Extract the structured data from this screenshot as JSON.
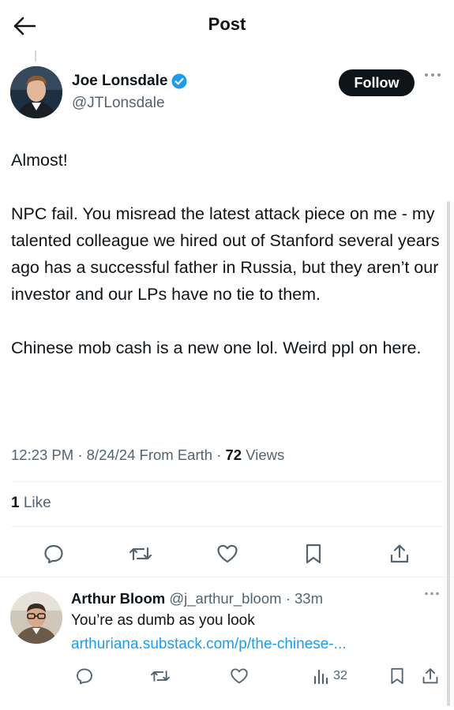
{
  "header": {
    "title": "Post",
    "back_icon": "arrow-left-icon"
  },
  "author": {
    "name": "Joe Lonsdale",
    "handle": "@JTLonsdale",
    "verified_color": "#1d9bf0",
    "follow_label": "Follow"
  },
  "post": {
    "paragraphs": [
      "Almost!",
      "NPC fail. You misread the latest attack piece on me - my talented colleague we hired out of Stanford several years ago has a successful father in Russia, but they aren’t our investor and our LPs have no tie to them.",
      "Chinese mob cash is a new one lol. Weird ppl on here."
    ],
    "time": "12:23 PM",
    "date": "8/24/24",
    "source": "From Earth",
    "views_count": "72",
    "views_label": "Views",
    "likes_count": "1",
    "likes_label": "Like"
  },
  "reply": {
    "name": "Arthur Bloom",
    "handle": "@j_arthur_bloom",
    "time": "33m",
    "text": "You’re as dumb as you look",
    "link": "arthuriana.substack.com/p/the-chinese-...",
    "views_count": "32"
  },
  "colors": {
    "text": "#0f1419",
    "secondary": "#536471",
    "accent": "#1d9bf0",
    "follow_bg": "#0f1419"
  }
}
